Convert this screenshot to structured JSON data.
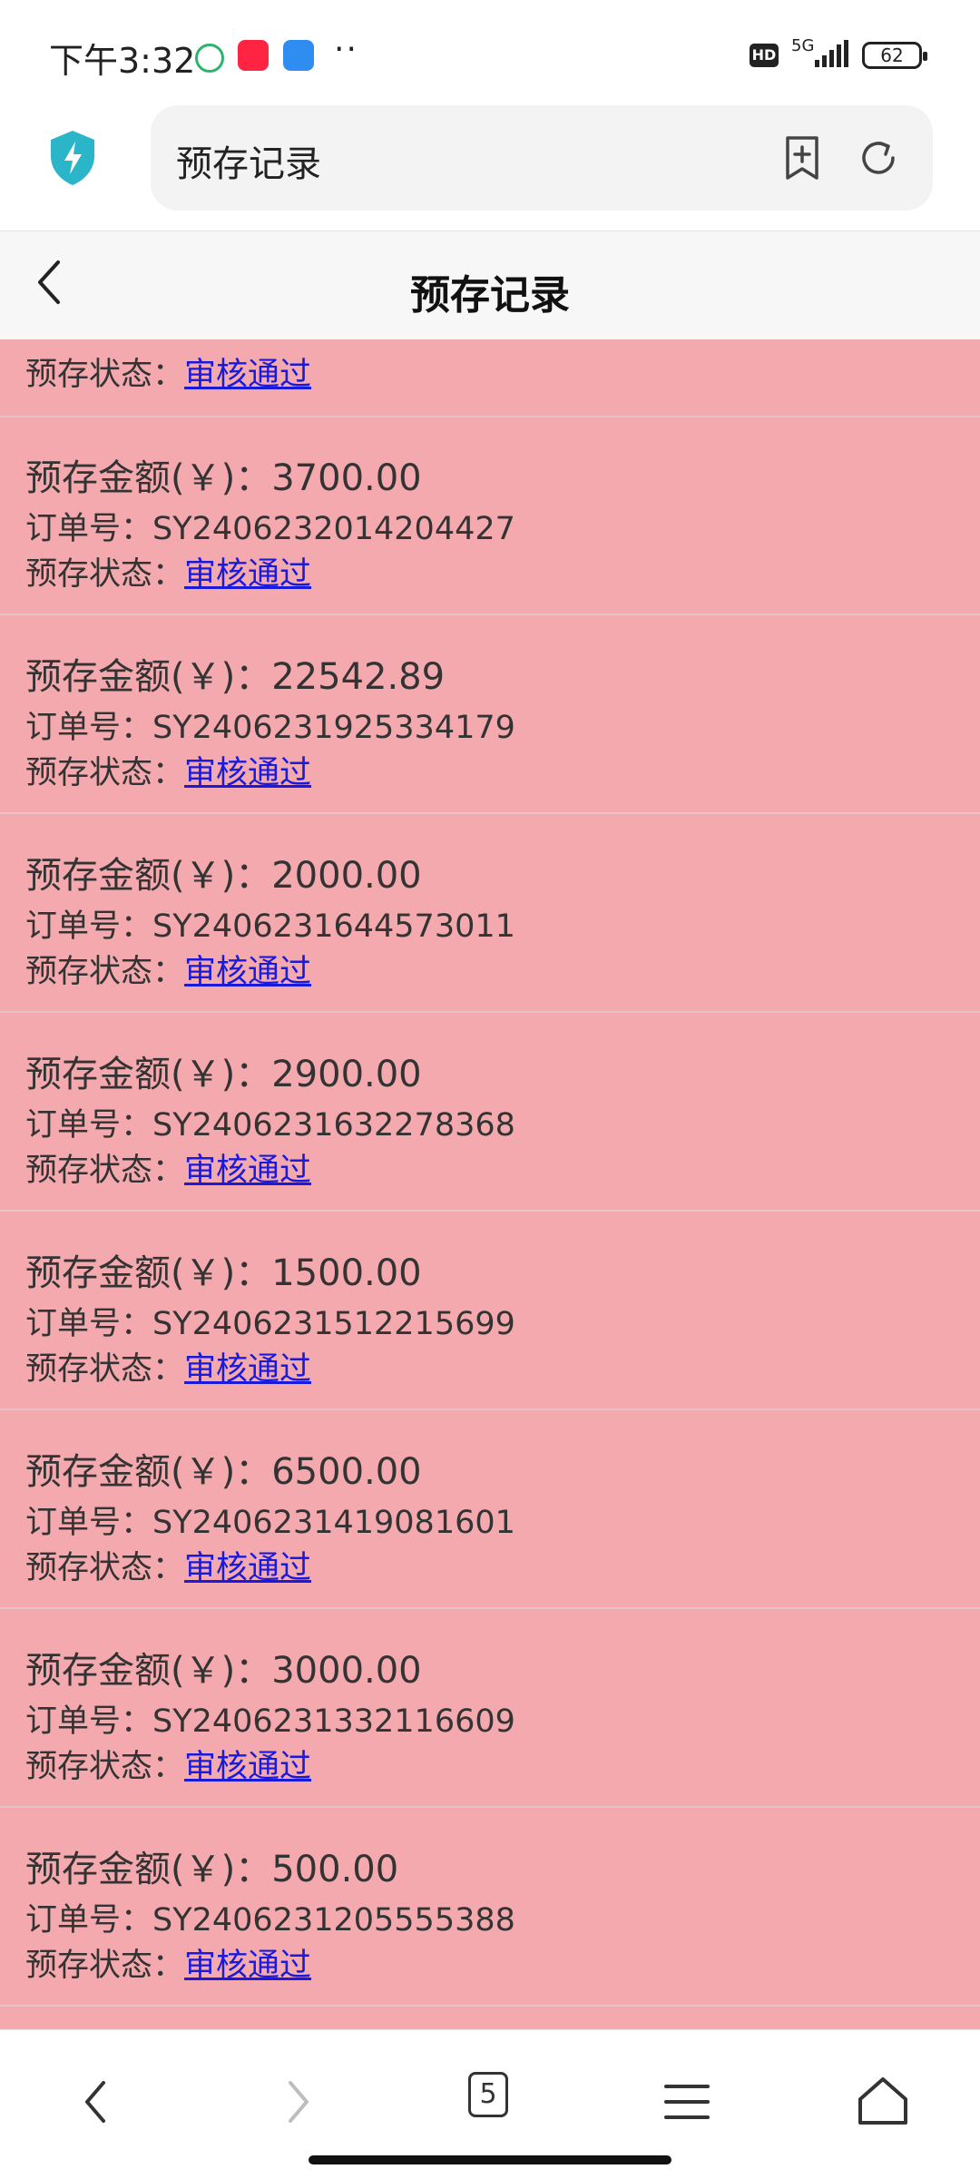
{
  "status_bar": {
    "time": "下午3:32",
    "network": "5G",
    "hd_badge": "HD",
    "battery": "62"
  },
  "browser": {
    "url_text": "预存记录",
    "tabs_count": "5"
  },
  "header": {
    "title": "预存记录"
  },
  "labels": {
    "amount": "预存金额(￥)：",
    "order": "订单号：",
    "status": "预存状态："
  },
  "partial_record": {
    "status": "审核通过"
  },
  "records": [
    {
      "amount": "3700.00",
      "order_no": "SY2406232014204427",
      "status": "审核通过"
    },
    {
      "amount": "22542.89",
      "order_no": "SY2406231925334179",
      "status": "审核通过"
    },
    {
      "amount": "2000.00",
      "order_no": "SY2406231644573011",
      "status": "审核通过"
    },
    {
      "amount": "2900.00",
      "order_no": "SY2406231632278368",
      "status": "审核通过"
    },
    {
      "amount": "1500.00",
      "order_no": "SY2406231512215699",
      "status": "审核通过"
    },
    {
      "amount": "6500.00",
      "order_no": "SY2406231419081601",
      "status": "审核通过"
    },
    {
      "amount": "3000.00",
      "order_no": "SY2406231332116609",
      "status": "审核通过"
    },
    {
      "amount": "500.00",
      "order_no": "SY2406231205555388",
      "status": "审核通过"
    }
  ],
  "colors": {
    "list_background": "#f4a9ae",
    "status_link": "#1a1adb",
    "shield_accent": "#2bb5c8"
  },
  "icons": [
    "back-icon",
    "forward-icon",
    "menu-icon",
    "home-icon",
    "bookmark-add-icon",
    "reload-icon",
    "shield-icon"
  ]
}
